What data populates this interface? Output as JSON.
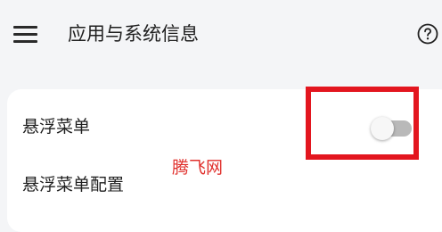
{
  "header": {
    "menu_icon": "hamburger-menu-icon",
    "title": "应用与系统信息",
    "help_icon": "help-circle-icon"
  },
  "settings": {
    "floating_menu": {
      "label": "悬浮菜单",
      "enabled": false
    },
    "floating_menu_config": {
      "label": "悬浮菜单配置"
    }
  },
  "annotation": {
    "highlight_color": "#e3161f"
  },
  "watermark": {
    "text": "腾飞网",
    "color": "#e0302c"
  },
  "colors": {
    "background": "#f4f5f7",
    "card": "#ffffff",
    "toggle_off_track": "#b9b9b9"
  }
}
